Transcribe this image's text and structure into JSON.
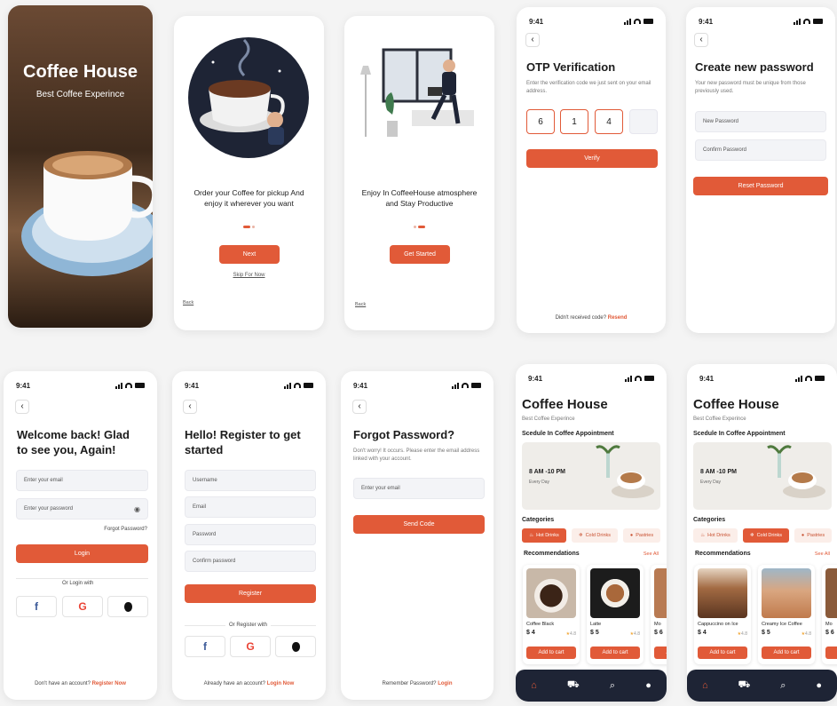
{
  "splash": {
    "title": "Coffee House",
    "subtitle": "Best Coffee Experince"
  },
  "onboard1": {
    "text": "Order your Coffee for pickup And enjoy it wherever you want",
    "button": "Next",
    "skip": "Skip For Now",
    "back": "Back"
  },
  "onboard2": {
    "text": "Enjoy In CoffeeHouse atmosphere and Stay Productive",
    "button": "Get Started",
    "back": "Back"
  },
  "time": "9:41",
  "otp": {
    "title": "OTP Verification",
    "desc": "Enter the verification code we just sent on your email address.",
    "digits": [
      "6",
      "1",
      "4",
      ""
    ],
    "button": "Verify",
    "resend_prefix": "Didn't received code?",
    "resend": "Resend"
  },
  "newpass": {
    "title": "Create new password",
    "desc": "Your new password must be unique from those previously used.",
    "new_ph": "New Password",
    "confirm_ph": "Confirm Password",
    "button": "Reset Password"
  },
  "login": {
    "title": "Welcome back! Glad to see you, Again!",
    "email_ph": "Enter your email",
    "pass_ph": "Enter your password",
    "forgot": "Forgot Password?",
    "button": "Login",
    "or": "Or Login with",
    "footer_prefix": "Don't have an account?",
    "footer_link": "Register Now"
  },
  "register": {
    "title": "Hello! Register to get started",
    "username_ph": "Username",
    "email_ph": "Email",
    "pass_ph": "Password",
    "confirm_ph": "Confirm password",
    "button": "Register",
    "or": "Or Register with",
    "footer_prefix": "Already have an account?",
    "footer_link": "Login Now"
  },
  "forgot": {
    "title": "Forgot Password?",
    "desc": "Don't worry! It occurs. Please enter the email address linked with your account.",
    "email_ph": "Enter your email",
    "button": "Send Code",
    "footer_prefix": "Remember Password?",
    "footer_link": "Login"
  },
  "home": {
    "title": "Coffee House",
    "subtitle": "Best Coffee Experince",
    "schedule": "Scedule In Coffee Appointment",
    "time": "8 AM -10 PM",
    "every": "Every Day",
    "categories": "Categories",
    "cats": [
      "Hot Drinks",
      "Cold Drinks",
      "Pastries"
    ],
    "recs": "Recommendations",
    "see_all": "See All",
    "add": "Add to cart"
  },
  "home_hot": {
    "items": [
      {
        "name": "Coffee Black",
        "price": "$ 4",
        "rating": "4.8"
      },
      {
        "name": "Latte",
        "price": "$ 5",
        "rating": "4.8"
      },
      {
        "name": "Mo",
        "price": "$ 6",
        "rating": ""
      }
    ]
  },
  "home_cold": {
    "items": [
      {
        "name": "Cappuccino on Ice",
        "price": "$ 4",
        "rating": "4.8"
      },
      {
        "name": "Creamy Ice Coffee",
        "price": "$ 5",
        "rating": "4.8"
      },
      {
        "name": "Mo",
        "price": "$ 6",
        "rating": ""
      }
    ]
  },
  "colors": {
    "accent": "#e15a38",
    "nav": "#1e2435"
  },
  "social_icons": {
    "facebook": "f",
    "google": "G",
    "apple": ""
  }
}
